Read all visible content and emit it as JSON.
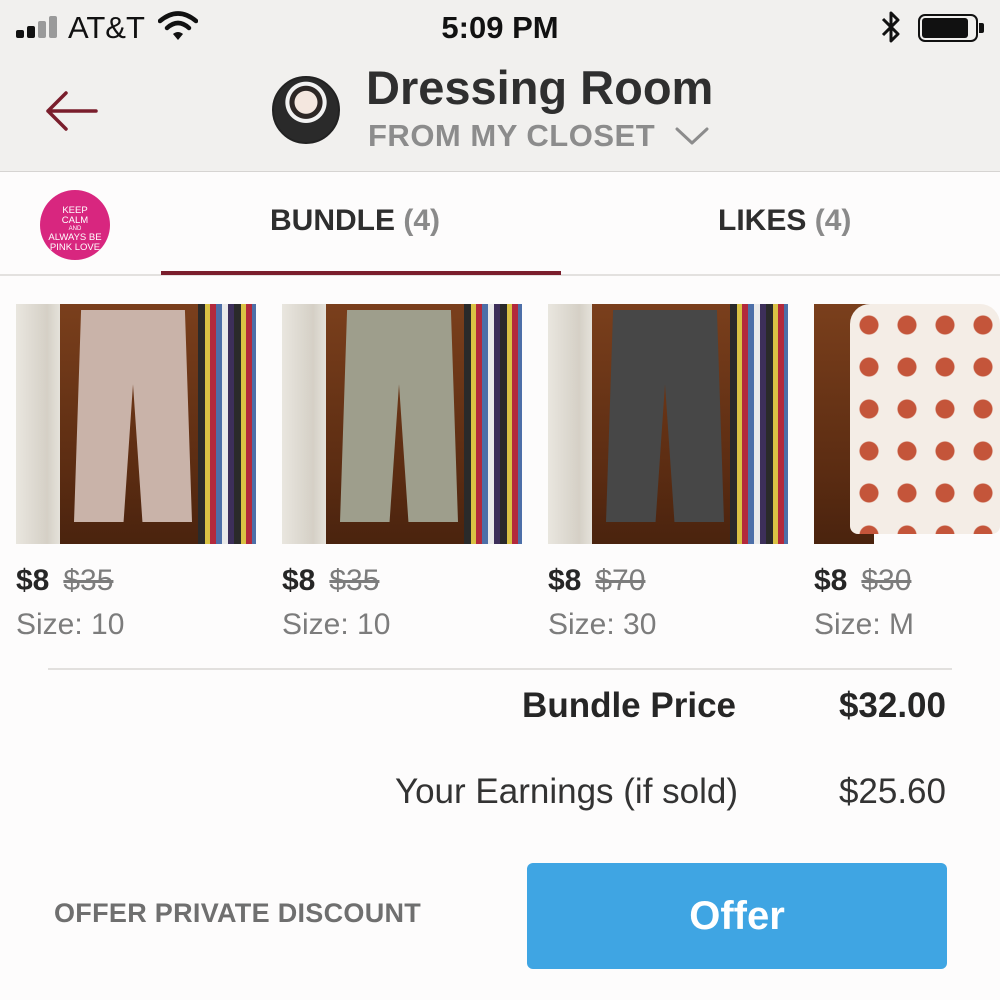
{
  "status_bar": {
    "carrier": "AT&T",
    "time": "5:09 PM"
  },
  "header": {
    "title": "Dressing Room",
    "subtitle": "FROM MY CLOSET"
  },
  "badge": {
    "line1": "KEEP",
    "line2": "CALM",
    "line3": "AND",
    "line4": "ALWAYS BE",
    "line5": "PINK LOVE"
  },
  "tabs": [
    {
      "label": "BUNDLE",
      "count": "(4)",
      "active": true
    },
    {
      "label": "LIKES",
      "count": "(4)",
      "active": false
    }
  ],
  "items": [
    {
      "price": "$8",
      "original_price": "$35",
      "size": "Size: 10",
      "pants_color": "#c9b3a9"
    },
    {
      "price": "$8",
      "original_price": "$35",
      "size": "Size: 10",
      "pants_color": "#9e9e8c"
    },
    {
      "price": "$8",
      "original_price": "$70",
      "size": "Size: 30",
      "pants_color": "#474747"
    },
    {
      "price": "$8",
      "original_price": "$30",
      "size": "Size: M",
      "pants_color": "#f4ede6"
    }
  ],
  "totals": {
    "bundle_price_label": "Bundle Price",
    "bundle_price_value": "$32.00",
    "earnings_label": "Your Earnings (if sold)",
    "earnings_value": "$25.60"
  },
  "actions": {
    "private_discount_label": "OFFER PRIVATE DISCOUNT",
    "offer_label": "Offer"
  },
  "colors": {
    "accent": "#7a1e2c",
    "offer_button": "#3fa5e3",
    "badge_pink": "#d8267f"
  },
  "icons": [
    "signal-icon",
    "wifi-icon",
    "bluetooth-icon",
    "battery-icon",
    "back-arrow-icon",
    "chevron-down-icon"
  ]
}
